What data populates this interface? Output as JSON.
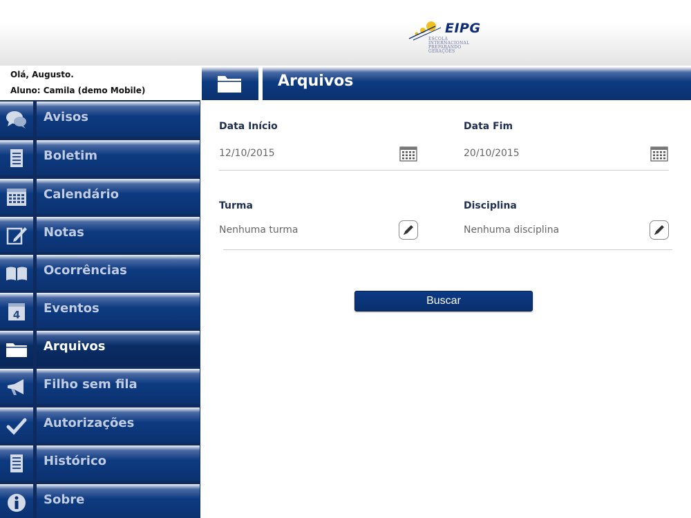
{
  "header": {
    "logo_text": "EIPG",
    "logo_sub": [
      "ESCOLA",
      "INTERNACIONAL",
      "PREPARANDO",
      "GERAÇÕES"
    ]
  },
  "user": {
    "greeting": "Olá, Augusto.",
    "student": "Aluno: Camila (demo Mobile)"
  },
  "sidebar": {
    "items": [
      {
        "label": "Avisos",
        "icon": "chat-bubbles-icon"
      },
      {
        "label": "Boletim",
        "icon": "document-icon"
      },
      {
        "label": "Calendário",
        "icon": "calendar-icon"
      },
      {
        "label": "Notas",
        "icon": "pencil-note-icon"
      },
      {
        "label": "Ocorrências",
        "icon": "open-book-icon"
      },
      {
        "label": "Eventos",
        "icon": "calendar-day-icon"
      },
      {
        "label": "Arquivos",
        "icon": "folder-icon",
        "active": true
      },
      {
        "label": "Filho sem fila",
        "icon": "megaphone-icon"
      },
      {
        "label": "Autorizações",
        "icon": "checkmark-icon"
      },
      {
        "label": "Histórico",
        "icon": "list-document-icon"
      },
      {
        "label": "Sobre",
        "icon": "info-icon"
      }
    ]
  },
  "page": {
    "title": "Arquivos",
    "title_icon": "folder-icon"
  },
  "form": {
    "data_inicio_label": "Data Início",
    "data_inicio_value": "12/10/2015",
    "data_fim_label": "Data Fim",
    "data_fim_value": "20/10/2015",
    "turma_label": "Turma",
    "turma_value": "Nenhuma turma",
    "disciplina_label": "Disciplina",
    "disciplina_value": "Nenhuma disciplina",
    "search_button": "Buscar"
  },
  "colors": {
    "brand_navy": "#0b3270",
    "nav_text": "#c3cde1",
    "active_text": "#ffffff"
  }
}
